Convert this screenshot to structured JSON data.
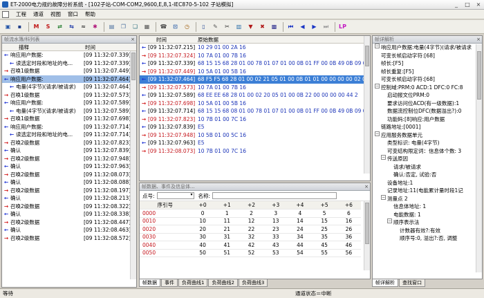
{
  "window": {
    "title": "ET-2000电力规约故障分析系统 - [102子站-COM-COM2,9600,E,8,1-IEC870-5-102 子站模拟]",
    "buttons": [
      "_",
      "□",
      "×"
    ]
  },
  "menu": [
    "工程",
    "通道",
    "视图",
    "窗口",
    "帮助"
  ],
  "toolbar": {
    "tools": [
      {
        "icon": "save-icon",
        "glyph": "▣",
        "color": "#2456a8"
      },
      {
        "icon": "floppy-icon",
        "glyph": "▪",
        "color": "#22408a"
      },
      {
        "icon": "m-icon",
        "glyph": "M",
        "color": "#c01818"
      },
      {
        "icon": "s-icon",
        "glyph": "S",
        "color": "#c01818"
      },
      {
        "icon": "swap-icon",
        "glyph": "⇄",
        "color": "#1e7a2a"
      },
      {
        "icon": "swap2-icon",
        "glyph": "⇆",
        "color": "#1e3aa8"
      },
      {
        "icon": "channel-icon",
        "glyph": "≈",
        "color": "#333"
      },
      {
        "icon": "color-icon",
        "glyph": "✱",
        "color": "#b0187a"
      },
      {
        "icon": "doc-icon",
        "glyph": "▤",
        "color": "#4a6f9e"
      },
      {
        "icon": "copy-icon",
        "glyph": "❐",
        "color": "#4a6f9e"
      },
      {
        "icon": "paste-icon",
        "glyph": "❏",
        "color": "#2b6e7d"
      },
      {
        "icon": "print-icon",
        "glyph": "▦",
        "color": "#555"
      },
      {
        "icon": "phone-icon",
        "glyph": "☎",
        "color": "#444"
      },
      {
        "icon": "lock-icon",
        "glyph": "⊡",
        "color": "#2b5fa8"
      },
      {
        "icon": "clock-icon",
        "glyph": "◷",
        "color": "#a06010"
      },
      {
        "icon": "new-icon",
        "glyph": "▯",
        "color": "#2c4f9a"
      },
      {
        "icon": "edit-icon",
        "glyph": "✎",
        "color": "#555"
      },
      {
        "icon": "cut-icon",
        "glyph": "✂",
        "color": "#333"
      },
      {
        "icon": "table-icon",
        "glyph": "▥",
        "color": "#2a6ea8"
      },
      {
        "icon": "filter-icon",
        "glyph": "▼",
        "color": "#b01818"
      },
      {
        "icon": "delete-icon",
        "glyph": "✖",
        "color": "#b01818"
      },
      {
        "icon": "grid-icon",
        "glyph": "▩",
        "color": "#2f2f8f"
      },
      {
        "icon": "first-icon",
        "glyph": "⏮",
        "color": "#1a35c4"
      },
      {
        "icon": "prev-icon",
        "glyph": "◀",
        "color": "#1a35c4"
      },
      {
        "icon": "next-icon",
        "glyph": "▶",
        "color": "#1a35c4"
      },
      {
        "icon": "last-icon",
        "glyph": "⏭",
        "color": "#999"
      },
      {
        "icon": "lp-icon",
        "glyph": "LP",
        "color": "#c216c2"
      }
    ]
  },
  "left_panel": {
    "title": "帧流水簿/科列表",
    "col_desc": "描释",
    "col_time": "时间",
    "rows": [
      {
        "arrow": "←",
        "dir": "blue",
        "indent": 0,
        "desc": "响应用户数据:",
        "time": "[09 11:32:07.339]",
        "sel": false
      },
      {
        "arrow": "←",
        "dir": "blue",
        "indent": 1,
        "desc": "读选定时段和地址的电...",
        "time": "[09 11:32:07.339]",
        "sel": false
      },
      {
        "arrow": "→",
        "dir": "red",
        "indent": 0,
        "desc": "召唤1级数据",
        "time": "[09 11:32:07.449]",
        "sel": false
      },
      {
        "arrow": "←",
        "dir": "blue",
        "indent": 0,
        "desc": "响应用户数据:",
        "time": "[09 11:32:07.464]",
        "sel": true
      },
      {
        "arrow": "←",
        "dir": "blue",
        "indent": 1,
        "desc": "电量(4字节)(请求/被请求)",
        "time": "[09 11:32:07.464]",
        "sel": false
      },
      {
        "arrow": "→",
        "dir": "red",
        "indent": 0,
        "desc": "召唤1级数据",
        "time": "[09 11:32:07.573]",
        "sel": false
      },
      {
        "arrow": "←",
        "dir": "blue",
        "indent": 0,
        "desc": "响应用户数据:",
        "time": "[09 11:32:07.589]",
        "sel": false
      },
      {
        "arrow": "←",
        "dir": "blue",
        "indent": 1,
        "desc": "电量(4字节)(请求/被请求)",
        "time": "[09 11:32:07.589]",
        "sel": false
      },
      {
        "arrow": "→",
        "dir": "red",
        "indent": 0,
        "desc": "召唤1级数据",
        "time": "[09 11:32:07.698]",
        "sel": false
      },
      {
        "arrow": "←",
        "dir": "blue",
        "indent": 0,
        "desc": "响应用户数据:",
        "time": "[09 11:32:07.714]",
        "sel": false
      },
      {
        "arrow": "←",
        "dir": "blue",
        "indent": 1,
        "desc": "读选定时段和地址的电...",
        "time": "[09 11:32:07.714]",
        "sel": false
      },
      {
        "arrow": "→",
        "dir": "red",
        "indent": 0,
        "desc": "召唤2级数据",
        "time": "[09 11:32:07.823]",
        "sel": false
      },
      {
        "arrow": "←",
        "dir": "blue",
        "indent": 0,
        "desc": "确认",
        "time": "[09 11:32:07.839]",
        "sel": false
      },
      {
        "arrow": "→",
        "dir": "red",
        "indent": 0,
        "desc": "召唤2级数据",
        "time": "[09 11:32:07.948]",
        "sel": false
      },
      {
        "arrow": "←",
        "dir": "blue",
        "indent": 0,
        "desc": "确认",
        "time": "[09 11:32:07.963]",
        "sel": false
      },
      {
        "arrow": "→",
        "dir": "red",
        "indent": 0,
        "desc": "召唤2级数据",
        "time": "[09 11:32:08.073]",
        "sel": false
      },
      {
        "arrow": "←",
        "dir": "blue",
        "indent": 0,
        "desc": "确认",
        "time": "[09 11:32:08.088]",
        "sel": false
      },
      {
        "arrow": "→",
        "dir": "red",
        "indent": 0,
        "desc": "召唤2级数据",
        "time": "[09 11:32:08.197]",
        "sel": false
      },
      {
        "arrow": "←",
        "dir": "blue",
        "indent": 0,
        "desc": "确认",
        "time": "[09 11:32:08.213]",
        "sel": false
      },
      {
        "arrow": "→",
        "dir": "red",
        "indent": 0,
        "desc": "召唤2级数据",
        "time": "[09 11:32:08.322]",
        "sel": false
      },
      {
        "arrow": "←",
        "dir": "blue",
        "indent": 0,
        "desc": "确认",
        "time": "[09 11:32:08.338]",
        "sel": false
      },
      {
        "arrow": "→",
        "dir": "red",
        "indent": 0,
        "desc": "召唤2级数据",
        "time": "[09 11:32:08.447]",
        "sel": false
      },
      {
        "arrow": "←",
        "dir": "blue",
        "indent": 0,
        "desc": "确认",
        "time": "[09 11:32:08.463]",
        "sel": false
      },
      {
        "arrow": "→",
        "dir": "red",
        "indent": 0,
        "desc": "召唤2级数据",
        "time": "[09 11:32:08.572]",
        "sel": false
      }
    ]
  },
  "mid_top": {
    "col_time": "时间",
    "col_raw": "原始数据",
    "rows": [
      {
        "arrow": "←",
        "dir": "blue",
        "time": "[09 11:32:07.215]",
        "raw": "10 29 01 00 2A 16",
        "sel": false
      },
      {
        "arrow": "→",
        "dir": "red",
        "time": "[09 11:32:07.324]",
        "raw": "10 7A 01 00 7B 16",
        "sel": false
      },
      {
        "arrow": "←",
        "dir": "blue",
        "time": "[09 11:32:07.339]",
        "raw": "68 15 15 68 28 01 00 78 01 07 01 00 0B 01 FF 00 0B 49 0B 09 0",
        "sel": false
      },
      {
        "arrow": "→",
        "dir": "red",
        "time": "[09 11:32:07.449]",
        "raw": "10 5A 01 00 5B 16",
        "sel": false
      },
      {
        "arrow": "←",
        "dir": "blue",
        "time": "[09 11:32:07.464]",
        "raw": "68 F5 F5 68 28 01 00 02 21 05 01 00 0B 01 01 00 00 00 00 02 0",
        "sel": true
      },
      {
        "arrow": "→",
        "dir": "red",
        "time": "[09 11:32:07.573]",
        "raw": "10 7A 01 00 7B 16",
        "sel": false
      },
      {
        "arrow": "←",
        "dir": "blue",
        "time": "[09 11:32:07.589]",
        "raw": "68 EE EE 68 28 01 00 02 20 05 01 00 0B 22 00 00 00 00 44 2",
        "sel": false
      },
      {
        "arrow": "→",
        "dir": "red",
        "time": "[09 11:32:07.698]",
        "raw": "10 5A 01 00 5B 16",
        "sel": false
      },
      {
        "arrow": "←",
        "dir": "blue",
        "time": "[09 11:32:07.714]",
        "raw": "68 15 15 68 08 01 00 78 01 07 01 00 0B 01 FF 00 0B 49 0B 09 0",
        "sel": false
      },
      {
        "arrow": "→",
        "dir": "red",
        "time": "[09 11:32:07.823]",
        "raw": "10 7B 01 00 7C 16",
        "sel": false
      },
      {
        "arrow": "←",
        "dir": "blue",
        "time": "[09 11:32:07.839]",
        "raw": "E5",
        "sel": false
      },
      {
        "arrow": "→",
        "dir": "red",
        "time": "[09 11:32:07.948]",
        "raw": "10 5B 01 00 5C 16",
        "sel": false
      },
      {
        "arrow": "←",
        "dir": "blue",
        "time": "[09 11:32:07.963]",
        "raw": "E5",
        "sel": false
      },
      {
        "arrow": "→",
        "dir": "red",
        "time": "[09 11:32:08.073]",
        "raw": "10 7B 01 00 7C 16",
        "sel": false
      }
    ]
  },
  "mid_bottom": {
    "title": "帧数据、事件及信息体...",
    "point_label": "点号:",
    "name_label": "名称:",
    "headers": [
      "序引号",
      "+0",
      "+1",
      "+2",
      "+3",
      "+4",
      "+5",
      "+6"
    ],
    "rows": [
      [
        "0000",
        "0",
        "1",
        "2",
        "3",
        "4",
        "5",
        "6"
      ],
      [
        "0010",
        "10",
        "11",
        "12",
        "13",
        "14",
        "15",
        "16"
      ],
      [
        "0020",
        "20",
        "21",
        "22",
        "23",
        "24",
        "25",
        "26"
      ],
      [
        "0030",
        "30",
        "31",
        "32",
        "33",
        "34",
        "35",
        "36"
      ],
      [
        "0040",
        "40",
        "41",
        "42",
        "43",
        "44",
        "45",
        "46"
      ],
      [
        "0050",
        "50",
        "51",
        "52",
        "53",
        "54",
        "55",
        "56"
      ]
    ],
    "tabs": [
      "帧数据",
      "事件",
      "负荷曲线1",
      "负荷曲线2",
      "负荷曲线3"
    ]
  },
  "right_panel": {
    "title": "帧详解析",
    "nodes": [
      {
        "lvl": 0,
        "tog": "−",
        "text": "响应用户数据:电量(4字节)(请求/被请求"
      },
      {
        "lvl": 1,
        "tog": "",
        "text": "可变长帧启动字符:[68]"
      },
      {
        "lvl": 1,
        "tog": "",
        "text": "帧长:[F5]"
      },
      {
        "lvl": 1,
        "tog": "",
        "text": "帧长重复:[F5]"
      },
      {
        "lvl": 1,
        "tog": "",
        "text": "可变长帧启动字符:[68]"
      },
      {
        "lvl": 0,
        "tog": "−",
        "text": "控制域:PRM:0 ACD:1 DFC:0 FC:8"
      },
      {
        "lvl": 2,
        "tog": "",
        "text": "启动报文位PRM:0"
      },
      {
        "lvl": 2,
        "tog": "",
        "text": "要求访问位ACD(有一级数据):1"
      },
      {
        "lvl": 2,
        "tog": "",
        "text": "数据流控制位DFC(数据溢出?):0"
      },
      {
        "lvl": 2,
        "tog": "",
        "text": "功能码:[8]响应:用户数据"
      },
      {
        "lvl": 1,
        "tog": "",
        "text": "链路地址:[0001]"
      },
      {
        "lvl": 0,
        "tog": "−",
        "text": "应用服务数据单元"
      },
      {
        "lvl": 2,
        "tog": "",
        "text": "类型标识: 电量(4字节)"
      },
      {
        "lvl": 2,
        "tog": "",
        "text": "可变结构限定词：信息体个数: 3"
      },
      {
        "lvl": 1,
        "tog": "−",
        "text": "传送原因"
      },
      {
        "lvl": 3,
        "tog": "",
        "text": "请求/被请求"
      },
      {
        "lvl": 3,
        "tog": "",
        "text": "确认:否定, 试验:否"
      },
      {
        "lvl": 2,
        "tog": "",
        "text": "设备地址:1"
      },
      {
        "lvl": 2,
        "tog": "",
        "text": "记录地址:11(电能累计量时段1记"
      },
      {
        "lvl": 1,
        "tog": "−",
        "text": "测量点 2"
      },
      {
        "lvl": 3,
        "tog": "",
        "text": "信息体地址: 1"
      },
      {
        "lvl": 3,
        "tog": "",
        "text": "电能数据: 1"
      },
      {
        "lvl": 2,
        "tog": "−",
        "text": "顺序表示法"
      },
      {
        "lvl": 4,
        "tog": "",
        "text": "计数器有效?:有效"
      },
      {
        "lvl": 4,
        "tog": "",
        "text": "顺序号:0, 溢出?:否, 调整"
      }
    ],
    "tabs": [
      "帧详解析",
      "查找窗口"
    ]
  },
  "status": {
    "left": "等待",
    "center": "通道状态＝中断"
  }
}
